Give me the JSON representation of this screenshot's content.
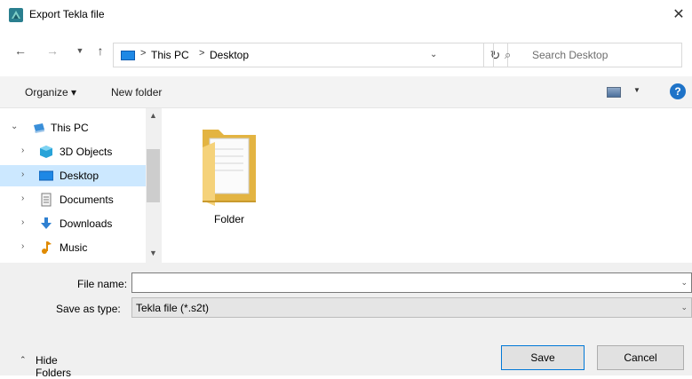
{
  "window": {
    "title": "Export Tekla file",
    "close_symbol": "✕"
  },
  "address": {
    "crumbs": [
      "This PC",
      "Desktop"
    ],
    "separator": ">"
  },
  "search": {
    "placeholder": "Search Desktop"
  },
  "toolbar": {
    "organize_label": "Organize ▾",
    "new_folder_label": "New folder",
    "help_label": "?"
  },
  "nav": {
    "items": [
      {
        "label": "This PC",
        "icon": "pc-icon",
        "expanded": true
      },
      {
        "label": "3D Objects",
        "icon": "3d-objects-icon"
      },
      {
        "label": "Desktop",
        "icon": "desktop-icon",
        "selected": true
      },
      {
        "label": "Documents",
        "icon": "documents-icon"
      },
      {
        "label": "Downloads",
        "icon": "downloads-icon"
      },
      {
        "label": "Music",
        "icon": "music-icon"
      }
    ]
  },
  "content": {
    "items": [
      {
        "label": "Folder",
        "icon": "folder-icon"
      }
    ]
  },
  "form": {
    "file_name_label": "File name:",
    "file_name_value": "",
    "save_as_type_label": "Save as type:",
    "save_as_type_value": "Tekla file (*.s2t)"
  },
  "footer": {
    "hide_folders_label": "Hide Folders",
    "save_label": "Save",
    "cancel_label": "Cancel"
  },
  "colors": {
    "selection": "#cce8ff",
    "accent": "#0078d7",
    "help": "#1e73c8"
  }
}
